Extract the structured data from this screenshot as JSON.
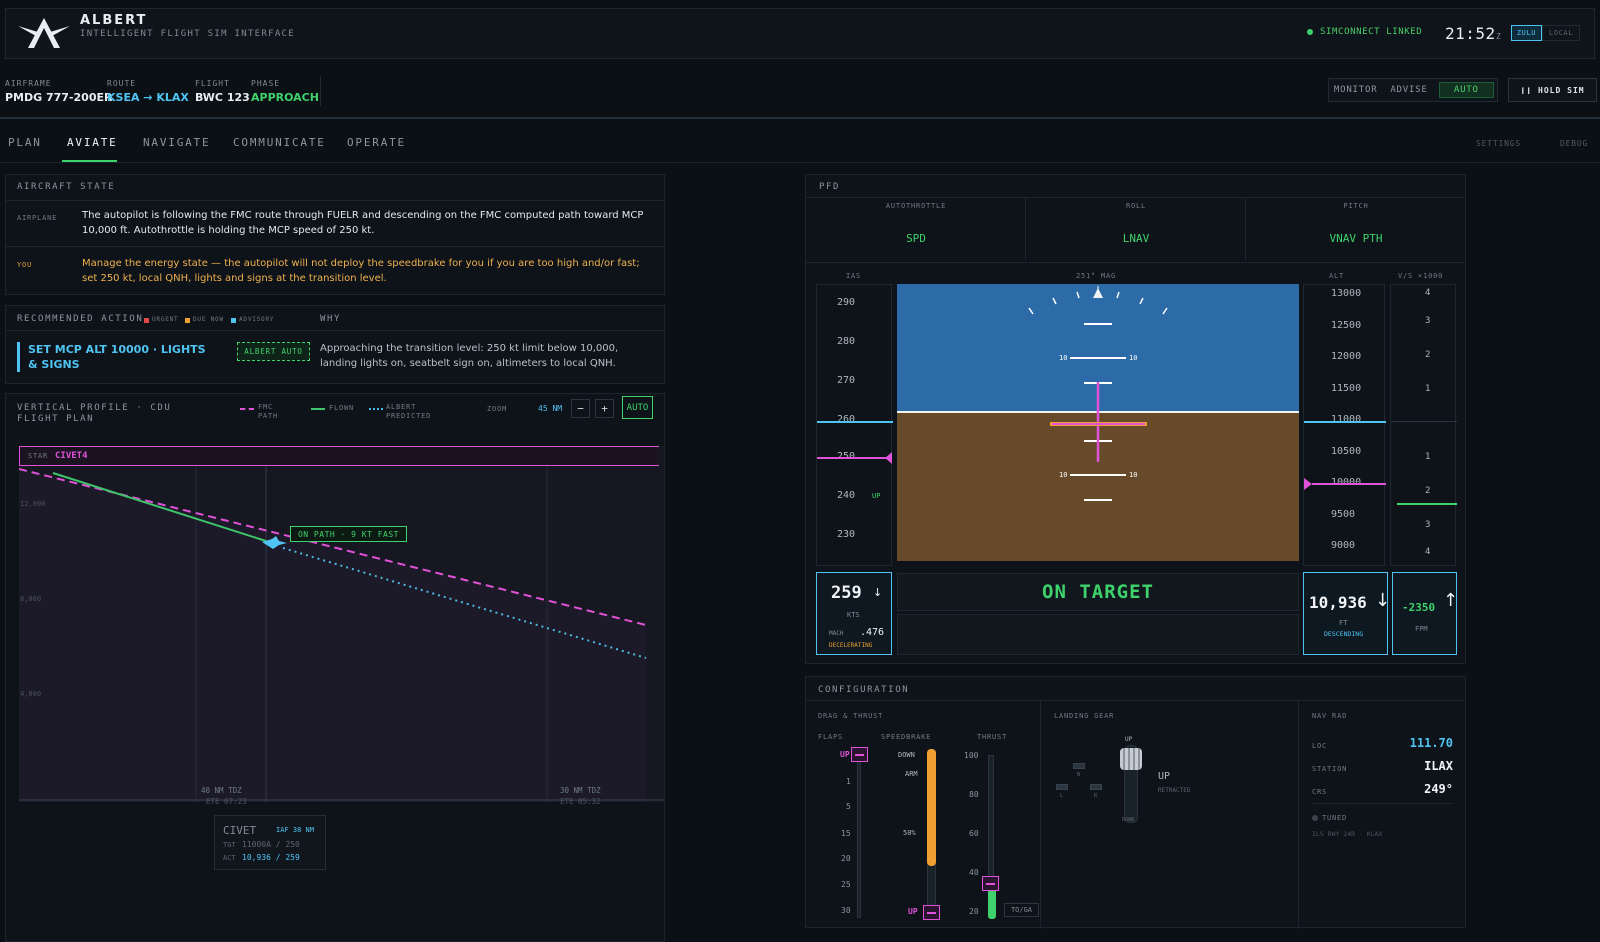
{
  "header": {
    "app_name": "ALBERT",
    "app_subtitle": "INTELLIGENT FLIGHT SIM INTERFACE",
    "status": "SIMCONNECT LINKED",
    "clock": "21:52",
    "clock_suffix": "Z",
    "time_modes": [
      "ZULU",
      "LOCAL"
    ],
    "active_time_mode": "ZULU"
  },
  "flight_info": {
    "airframe_label": "AIRFRAME",
    "airframe": "PMDG 777-200ER",
    "route_label": "ROUTE",
    "route": "KSEA → KLAX",
    "flight_label": "FLIGHT",
    "flight": "BWC 123",
    "phase_label": "PHASE",
    "phase": "APPROACH"
  },
  "modes": {
    "items": [
      "MONITOR",
      "ADVISE",
      "AUTO"
    ],
    "active": "AUTO",
    "hold_label": "HOLD SIM"
  },
  "tabs": {
    "items": [
      "PLAN",
      "AVIATE",
      "NAVIGATE",
      "COMMUNICATE",
      "OPERATE"
    ],
    "active": "AVIATE",
    "right": [
      "SETTINGS",
      "DEBUG"
    ]
  },
  "aircraft_state": {
    "title": "AIRCRAFT STATE",
    "airplane_label": "AIRPLANE",
    "airplane_text": "The autopilot is following the FMC route through FUELR and descending on the FMC computed path toward MCP 10,000 ft. Autothrottle is holding the MCP speed of 250 kt.",
    "you_label": "YOU",
    "you_text": "Manage the energy state — the autopilot will not deploy the speedbrake for you if you are too high and/or fast; set 250 kt, local QNH, lights and signs at the transition level."
  },
  "recommended": {
    "title": "RECOMMENDED ACTION",
    "legend": [
      "URGENT",
      "DUE NOW",
      "ADVISORY"
    ],
    "why_label": "WHY",
    "action": "SET MCP ALT 10000 · LIGHTS & SIGNS",
    "badge": "ALBERT AUTO",
    "why_text": "Approaching the transition level: 250 kt limit below 10,000, landing lights on, seatbelt sign on, altimeters to local QNH."
  },
  "profile": {
    "title": "VERTICAL PROFILE · CDU FLIGHT PLAN",
    "legend_fmc": "FMC PATH",
    "legend_flown": "FLOWN",
    "legend_pred": "ALBERT PREDICTED",
    "zoom_label": "ZOOM",
    "zoom_value": "45 NM",
    "minus": "−",
    "plus": "+",
    "auto": "AUTO",
    "star_label": "STAR",
    "star_name": "CIVET4",
    "y_ticks": [
      "12,000",
      "8,000",
      "4,000"
    ],
    "on_path": "ON PATH · 9 KT FAST",
    "tdz_left": "40 NM TDZ",
    "tdz_left_ete": "ETE 07:23",
    "tdz_right": "30 NM TDZ",
    "tdz_right_ete": "ETE 05:32",
    "wpt_name": "CIVET",
    "wpt_iaf": "IAF 38 NM",
    "wpt_tgt_label": "TGT",
    "wpt_tgt": "11000A / 250",
    "wpt_act_label": "ACT",
    "wpt_act": "10,936 / 259"
  },
  "pfd": {
    "title": "PFD",
    "fma": [
      {
        "label": "AUTOTHROTTLE",
        "value": "SPD"
      },
      {
        "label": "ROLL",
        "value": "LNAV"
      },
      {
        "label": "PITCH",
        "value": "VNAV PTH"
      }
    ],
    "ias_label": "IAS",
    "heading": "251° MAG",
    "alt_label": "ALT",
    "vs_label": "V/S ×1000",
    "speed_ticks": [
      "290",
      "280",
      "270",
      "260",
      "250",
      "240",
      "230"
    ],
    "up_marker": "UP",
    "alt_ticks": [
      "13000",
      "12500",
      "12000",
      "11500",
      "11000",
      "10500",
      "10000",
      "9500",
      "9000"
    ],
    "vs_ticks": [
      "4",
      "3",
      "2",
      "1",
      "1",
      "2",
      "3",
      "4"
    ],
    "pitch_labels": [
      "10",
      "10",
      "10",
      "10"
    ],
    "speed": "259",
    "speed_unit": "KTS",
    "mach_label": "MACH",
    "mach": ".476",
    "speed_trend": "DECELERATING",
    "status": "ON TARGET",
    "altitude": "10,936",
    "alt_unit": "FT",
    "alt_trend": "DESCENDING",
    "vs": "-2350",
    "vs_unit": "FPM"
  },
  "config": {
    "title": "CONFIGURATION",
    "drag_title": "DRAG & THRUST",
    "flaps_label": "FLAPS",
    "flaps_ticks": [
      "UP",
      "1",
      "5",
      "15",
      "20",
      "25",
      "30"
    ],
    "speedbrake_label": "SPEEDBRAKE",
    "sb_down": "DOWN",
    "sb_arm": "ARM",
    "sb_50": "50%",
    "sb_up": "UP",
    "thrust_label": "THRUST",
    "thrust_ticks": [
      "100",
      "80",
      "60",
      "40",
      "20"
    ],
    "toga": "TO/GA",
    "gear_title": "LANDING GEAR",
    "gear_up": "UP",
    "gear_down": "DOWN",
    "gear_n": "N",
    "gear_l": "L",
    "gear_r": "R",
    "gear_state": "UP",
    "gear_state_sub": "RETRACTED",
    "nav_title": "NAV RAD",
    "loc_label": "LOC",
    "loc": "111.70",
    "station_label": "STATION",
    "station": "ILAX",
    "crs_label": "CRS",
    "crs": "249°",
    "tuned": "TUNED",
    "tuned_sub": "ILS RWY 24R · KLAX"
  },
  "chart_data": {
    "type": "line",
    "title": "VERTICAL PROFILE · CDU FLIGHT PLAN",
    "y_ticks": [
      "12,000",
      "8,000",
      "4,000"
    ],
    "series": [
      {
        "name": "FMC PATH",
        "color": "#e052d8"
      },
      {
        "name": "FLOWN",
        "color": "#3ec46a"
      },
      {
        "name": "ALBERT PREDICTED",
        "color": "#4fb8e0"
      }
    ]
  },
  "colors": {
    "accent_green": "#3fd16b",
    "accent_cyan": "#4fc3f2",
    "magenta": "#e052d8",
    "orange": "#f0a030",
    "sky": "#2a6aa8",
    "ground": "#664a2a"
  }
}
